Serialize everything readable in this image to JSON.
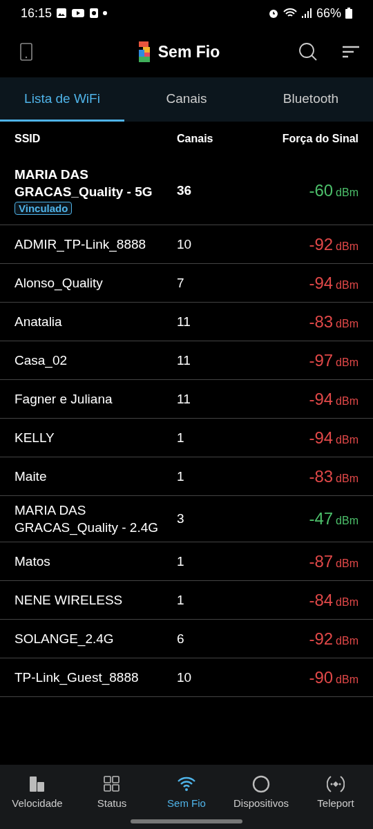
{
  "status_bar": {
    "time": "16:15",
    "battery": "66%"
  },
  "app_bar": {
    "title": "Sem Fio"
  },
  "tabs": [
    {
      "label": "Lista de WiFi",
      "selected": true
    },
    {
      "label": "Canais",
      "selected": false
    },
    {
      "label": "Bluetooth",
      "selected": false
    }
  ],
  "table": {
    "columns": [
      "SSID",
      "Canais",
      "Força do Sinal"
    ],
    "rows": [
      {
        "ssid": "MARIA DAS GRACAS_Quality -  5G",
        "channel": "36",
        "signal": "-60",
        "unit": "dBm",
        "color": "#4cbf6a",
        "linked": true,
        "badge": "Vinculado"
      },
      {
        "ssid": "ADMIR_TP-Link_8888",
        "channel": "10",
        "signal": "-92",
        "unit": "dBm",
        "color": "#e04848",
        "linked": false
      },
      {
        "ssid": "Alonso_Quality",
        "channel": "7",
        "signal": "-94",
        "unit": "dBm",
        "color": "#e04848",
        "linked": false
      },
      {
        "ssid": "Anatalia",
        "channel": "11",
        "signal": "-83",
        "unit": "dBm",
        "color": "#e04848",
        "linked": false
      },
      {
        "ssid": "Casa_02",
        "channel": "11",
        "signal": "-97",
        "unit": "dBm",
        "color": "#e04848",
        "linked": false
      },
      {
        "ssid": "Fagner e Juliana",
        "channel": "11",
        "signal": "-94",
        "unit": "dBm",
        "color": "#e04848",
        "linked": false
      },
      {
        "ssid": "KELLY",
        "channel": "1",
        "signal": "-94",
        "unit": "dBm",
        "color": "#e04848",
        "linked": false
      },
      {
        "ssid": "Maite",
        "channel": "1",
        "signal": "-83",
        "unit": "dBm",
        "color": "#e04848",
        "linked": false
      },
      {
        "ssid": "MARIA DAS GRACAS_Quality - 2.4G",
        "channel": "3",
        "signal": "-47",
        "unit": "dBm",
        "color": "#4cbf6a",
        "linked": false
      },
      {
        "ssid": "Matos",
        "channel": "1",
        "signal": "-87",
        "unit": "dBm",
        "color": "#e04848",
        "linked": false
      },
      {
        "ssid": "NENE WIRELESS",
        "channel": "1",
        "signal": "-84",
        "unit": "dBm",
        "color": "#e04848",
        "linked": false
      },
      {
        "ssid": "SOLANGE_2.4G",
        "channel": "6",
        "signal": "-92",
        "unit": "dBm",
        "color": "#e04848",
        "linked": false
      },
      {
        "ssid": "TP-Link_Guest_8888",
        "channel": "10",
        "signal": "-90",
        "unit": "dBm",
        "color": "#e04848",
        "linked": false
      }
    ]
  },
  "bottom_nav": [
    {
      "label": "Velocidade",
      "kind": "speed",
      "selected": false
    },
    {
      "label": "Status",
      "kind": "grid",
      "selected": false
    },
    {
      "label": "Sem Fio",
      "kind": "wifi",
      "selected": true
    },
    {
      "label": "Dispositivos",
      "kind": "circle",
      "selected": false
    },
    {
      "label": "Teleport",
      "kind": "teleport",
      "selected": false
    }
  ]
}
